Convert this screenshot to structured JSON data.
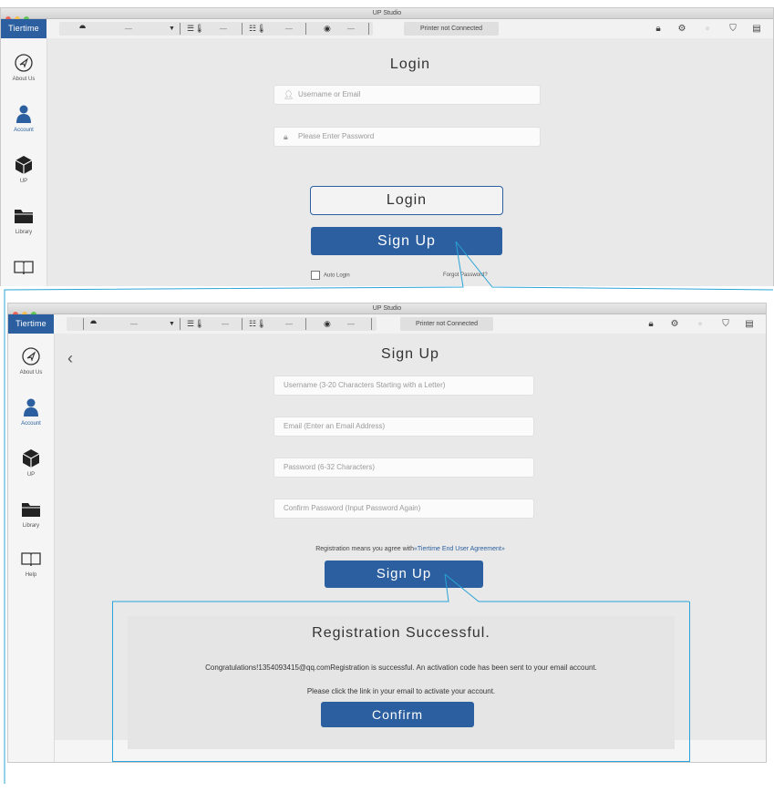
{
  "app": {
    "title": "UP Studio",
    "brand": "Tiertime"
  },
  "toolbar": {
    "dash": "—",
    "status": "Printer not Connected"
  },
  "sidebar": {
    "items": [
      {
        "label": "About Us",
        "icon": "navigate-icon"
      },
      {
        "label": "Account",
        "icon": "user-icon"
      },
      {
        "label": "UP",
        "icon": "cube-icon"
      },
      {
        "label": "Library",
        "icon": "folder-icon"
      },
      {
        "label": "Help",
        "icon": "book-icon"
      }
    ]
  },
  "login": {
    "title": "Login",
    "username_placeholder": "Username or Email",
    "password_placeholder": "Please Enter Password",
    "login_button": "Login",
    "signup_button": "Sign Up",
    "auto_login": "Auto Login",
    "forgot_password": "Forgot Password?"
  },
  "signup": {
    "title": "Sign Up",
    "username_placeholder": "Username (3-20 Characters Starting with a Letter)",
    "email_placeholder": "Email (Enter an Email Address)",
    "password_placeholder": "Password (6-32 Characters)",
    "confirm_placeholder": "Confirm Password (Input Password Again)",
    "agree_text": "Registration means you agree with",
    "agree_link": "«Tiertime End User Agreement»",
    "signup_button": "Sign Up"
  },
  "dialog": {
    "title": "Registration Successful.",
    "message1": "Congratulations!1354093415@qq.comRegistration is successful. An activation code has been sent to your email account.",
    "message2": "Please click the link in your email to activate your account.",
    "confirm_button": "Confirm"
  },
  "colors": {
    "accent": "#2c5fa0",
    "callout": "#2aa3d6"
  }
}
